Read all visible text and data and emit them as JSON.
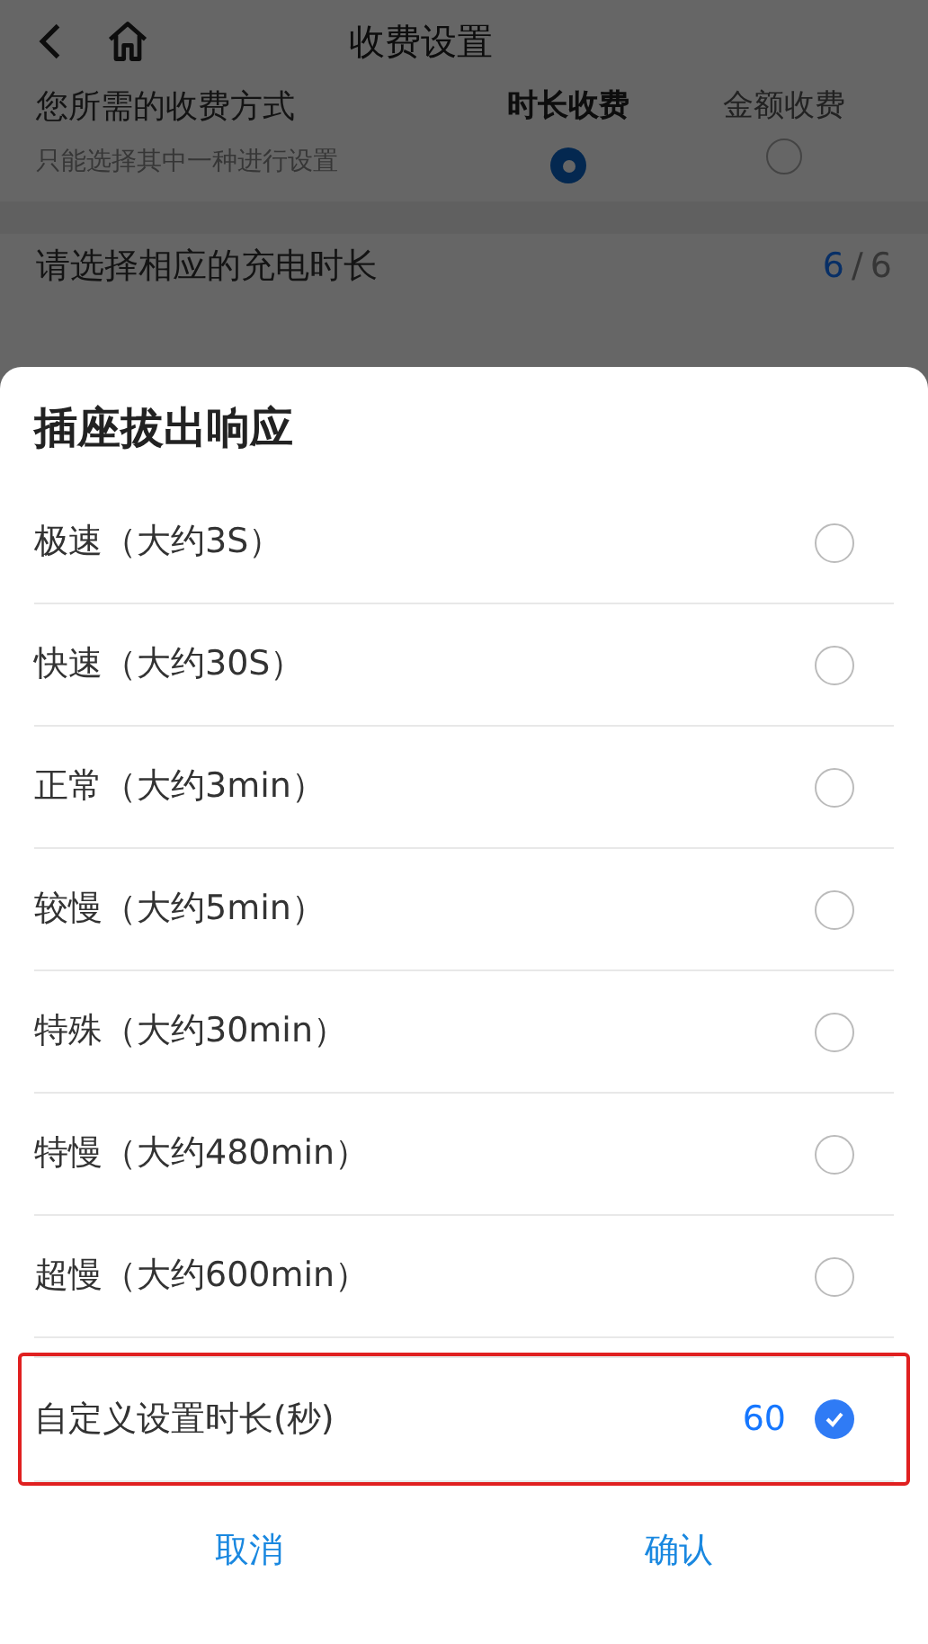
{
  "header": {
    "title": "收费设置"
  },
  "fee_mode": {
    "label": "您所需的收费方式",
    "hint": "只能选择其中一种进行设置",
    "options": [
      {
        "label": "时长收费",
        "selected": true
      },
      {
        "label": "金额收费",
        "selected": false
      }
    ]
  },
  "duration": {
    "label": "请选择相应的充电时长",
    "count": "6",
    "separator": "/",
    "total": "6"
  },
  "sheet": {
    "title": "插座拔出响应",
    "options": [
      {
        "label": "极速（大约3S）",
        "selected": false
      },
      {
        "label": "快速（大约30S）",
        "selected": false
      },
      {
        "label": "正常（大约3min）",
        "selected": false
      },
      {
        "label": "较慢（大约5min）",
        "selected": false
      },
      {
        "label": "特殊（大约30min）",
        "selected": false
      },
      {
        "label": "特慢（大约480min）",
        "selected": false
      },
      {
        "label": "超慢（大约600min）",
        "selected": false
      }
    ],
    "custom": {
      "label": "自定义设置时长(秒)",
      "value": "60",
      "selected": true,
      "highlighted": true
    },
    "buttons": [
      "取消",
      "确认"
    ]
  }
}
